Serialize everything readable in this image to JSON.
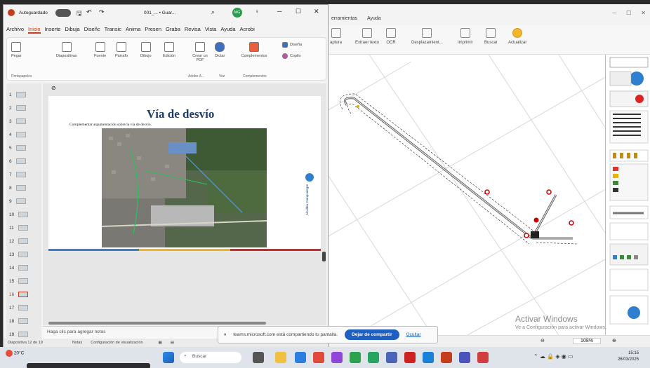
{
  "pdf_window": {
    "menu": [
      "erramientas",
      "Ayuda"
    ],
    "tools": [
      {
        "label": "aptura"
      },
      {
        "label": "Extraer texto"
      },
      {
        "label": "OCR"
      },
      {
        "label": "Desplazamient..."
      },
      {
        "label": "Imprimir"
      },
      {
        "label": "Buscar"
      },
      {
        "label": "Actualizar"
      }
    ],
    "zoom": "108%",
    "activate_title": "Activar Windows",
    "activate_sub": "Ve a Configuración para activar Windows."
  },
  "ppt_window": {
    "autosave_label": "Autoguardado",
    "filename": "001_... • Guar...",
    "user_initials": "MG",
    "tabs": [
      "Archivo",
      "Inicio",
      "Inserte",
      "Dibuja",
      "Diseñc",
      "Transic",
      "Anima",
      "Presen",
      "Graba",
      "Revisa",
      "Vista",
      "Ayuda",
      "Acrobi"
    ],
    "active_tab": "Inicio",
    "ribbon_buttons": [
      "Pegar",
      "Diapositivas",
      "Fuente",
      "Párrafo",
      "Dibujo",
      "Edición",
      "Crear un PDF",
      "Dictar",
      "Complementos",
      "Diseña",
      "Copilo"
    ],
    "ribbon_groups": [
      "Portapapeles",
      "Adobe A...",
      "Voz",
      "Complementos"
    ],
    "slide_numbers": [
      "1",
      "2",
      "3",
      "4",
      "5",
      "6",
      "7",
      "8",
      "9",
      "10",
      "11",
      "12",
      "13",
      "14",
      "15",
      "16",
      "17",
      "18",
      "19"
    ],
    "active_slide": "16",
    "slide": {
      "title": "Vía de desvío",
      "subtitle": "Complementar argumentación sobre la vía de desvío.",
      "side_text": "Alcaldía Campoalegre",
      "bar_colors": [
        "#3b7dc4",
        "#f0b323",
        "#c42b2b"
      ]
    },
    "notes_placeholder": "Haga clic para agregar notas",
    "status": {
      "slide_info": "Diapositiva 12 de 19",
      "notes_btn": "Notas",
      "view_settings": "Configuración de visualización"
    }
  },
  "share_banner": {
    "message": "teams.microsoft.com está compartiendo tu pantalla.",
    "stop_btn": "Dejar de compartir",
    "hide_btn": "Ocultar"
  },
  "taskbar": {
    "temperature": "20°C",
    "search_placeholder": "Buscar",
    "time": "15:15",
    "date": "26/03/2025"
  }
}
